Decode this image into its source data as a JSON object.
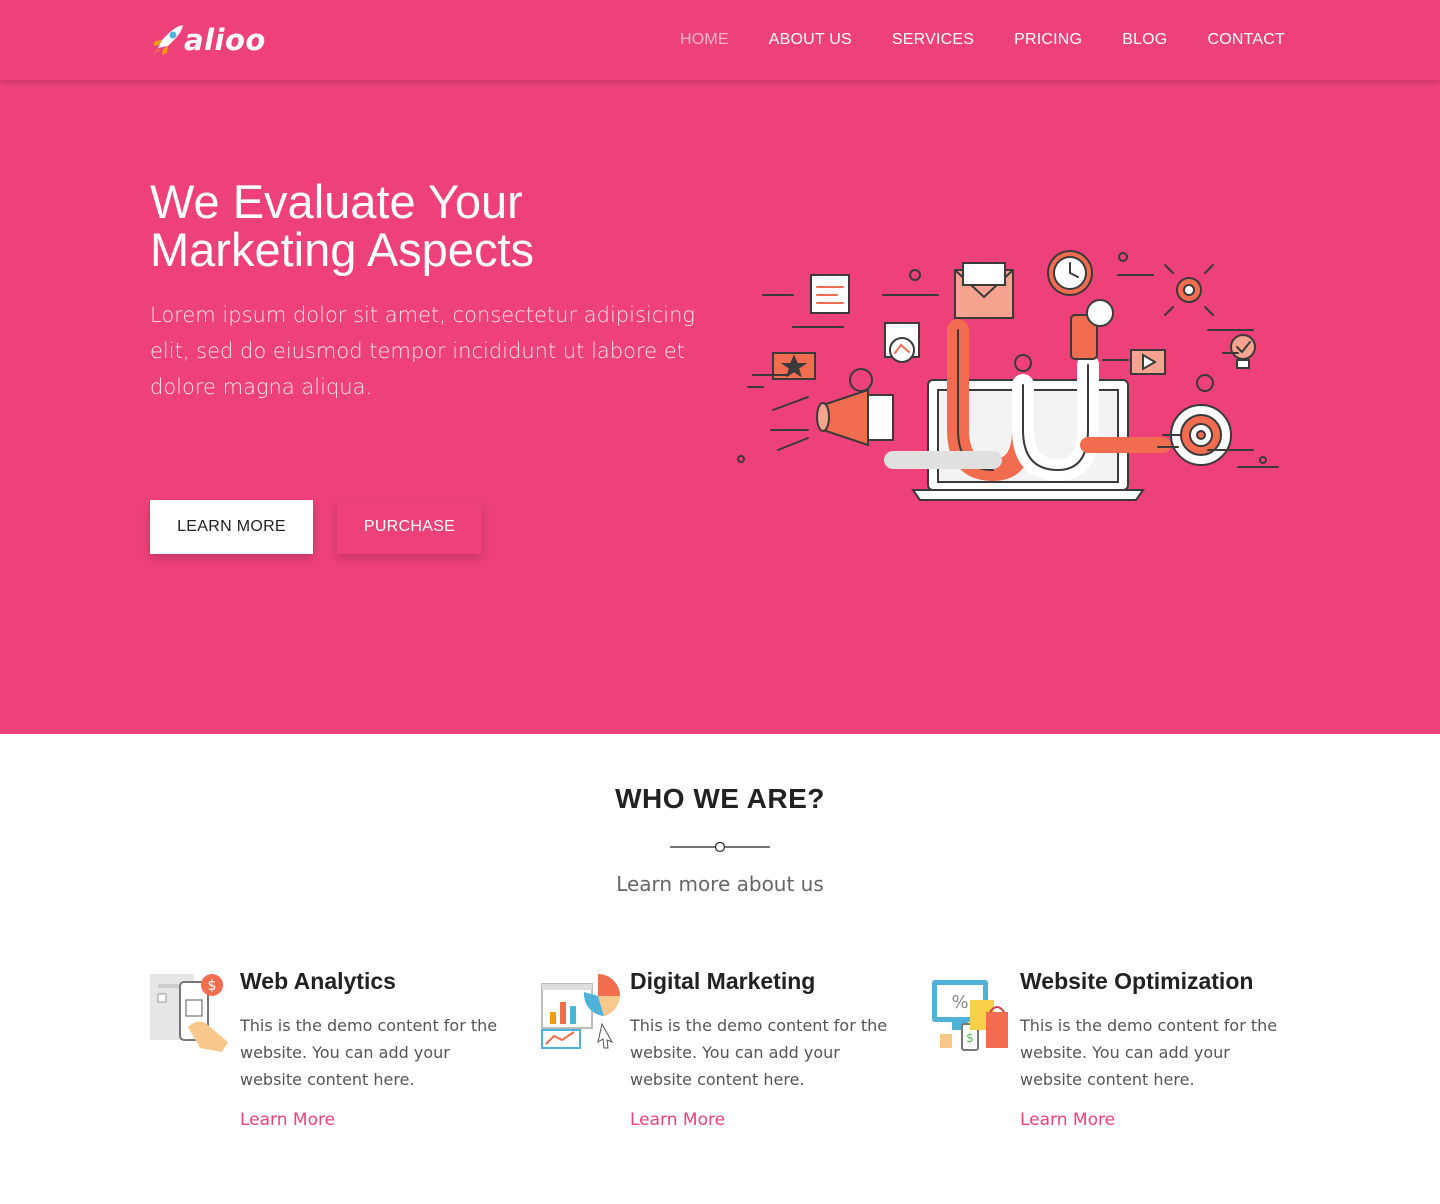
{
  "brand": {
    "name": "alioo",
    "logo_icon": "rocket-icon"
  },
  "nav": {
    "items": [
      {
        "label": "HOME",
        "active": true
      },
      {
        "label": "ABOUT US",
        "active": false
      },
      {
        "label": "SERVICES",
        "active": false
      },
      {
        "label": "PRICING",
        "active": false
      },
      {
        "label": "BLOG",
        "active": false
      },
      {
        "label": "CONTACT",
        "active": false
      }
    ]
  },
  "hero": {
    "title_line1": "We Evaluate Your",
    "title_line2": "Marketing Aspects",
    "text": "Lorem ipsum dolor sit amet, consectetur adipisicing elit, sed do eiusmod tempor incididunt ut labore et dolore magna aliqua.",
    "learn_more_label": "LEARN MORE",
    "purchase_label": "PURCHASE",
    "illustration_icon": "marketing-funnel-illustration"
  },
  "who": {
    "title": "WHO WE ARE?",
    "subtitle": "Learn more about us"
  },
  "features": [
    {
      "title": "Web Analytics",
      "text": "This is the demo content for the website. You can add your website content here.",
      "link": "Learn More",
      "icon": "mobile-payment-icon"
    },
    {
      "title": "Digital Marketing",
      "text": "This is the demo content for the website. You can add your website content here.",
      "link": "Learn More",
      "icon": "analytics-dashboard-icon"
    },
    {
      "title": "Website Optimization",
      "text": "This is the demo content for the website. You can add your website content here.",
      "link": "Learn More",
      "icon": "ecommerce-devices-icon"
    }
  ],
  "colors": {
    "primary": "#ee417a",
    "accent_orange": "#f26c4f",
    "text_dark": "#222222"
  }
}
